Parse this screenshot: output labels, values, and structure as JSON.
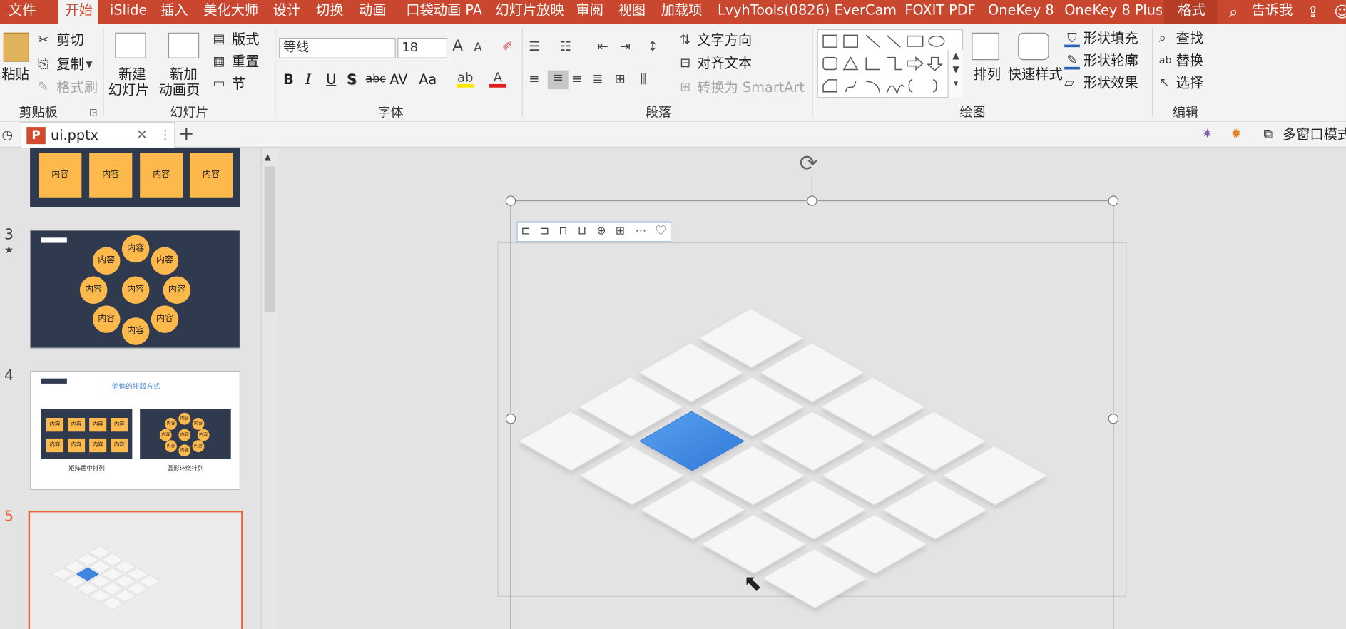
{
  "menubar": {
    "tabs": [
      "文件",
      "开始",
      "iSlide",
      "插入",
      "美化大师",
      "设计",
      "切换",
      "动画",
      "口袋动画 PA",
      "幻灯片放映",
      "审阅",
      "视图",
      "加载项",
      "LvyhTools(0826)",
      "EverCam",
      "FOXIT PDF",
      "OneKey 8",
      "OneKey 8 Plus",
      "格式"
    ],
    "active_tab": "开始",
    "tell_me": "告诉我",
    "accent": "#c8472e"
  },
  "ribbon": {
    "clipboard": {
      "paste": "粘贴",
      "cut": "剪切",
      "copy": "复制",
      "format_painter": "格式刷",
      "group": "剪贴板"
    },
    "slides": {
      "new_slide_1": "新建",
      "new_slide_2": "幻灯片",
      "new_anim_1": "新加",
      "new_anim_2": "动画页",
      "layout": "版式",
      "reset": "重置",
      "section": "节",
      "group": "幻灯片"
    },
    "font": {
      "name": "等线",
      "size": "18",
      "bold": "B",
      "italic": "I",
      "underline": "U",
      "shadow": "S",
      "strike": "abc",
      "spacing": "AV",
      "case": "Aa",
      "group": "字体"
    },
    "paragraph": {
      "text_direction": "文字方向",
      "align_text": "对齐文本",
      "smartart": "转换为 SmartArt",
      "group": "段落"
    },
    "drawing": {
      "arrange": "排列",
      "quick_styles": "快速样式",
      "shape_fill": "形状填充",
      "shape_outline": "形状轮廓",
      "shape_effects": "形状效果",
      "group": "绘图"
    },
    "editing": {
      "find": "查找",
      "replace": "替换",
      "select": "选择",
      "group": "编辑"
    }
  },
  "tabs": {
    "doc": "ui.pptx",
    "multiwindow": "多窗口模式"
  },
  "thumbnails": {
    "slide_numbers": [
      "3",
      "4",
      "5"
    ],
    "content_label": "内容",
    "slide4_title": "偷偷的排版方式",
    "slide4_left": "矩阵居中排列",
    "slide4_right": "圆形环绕排列",
    "star": "★",
    "selected_color": "#e8603c"
  },
  "colors": {
    "tile": "#f6f6f6",
    "highlight": "#3d86e3",
    "orange": "#fdb94c",
    "navy": "#2f3a4f"
  }
}
